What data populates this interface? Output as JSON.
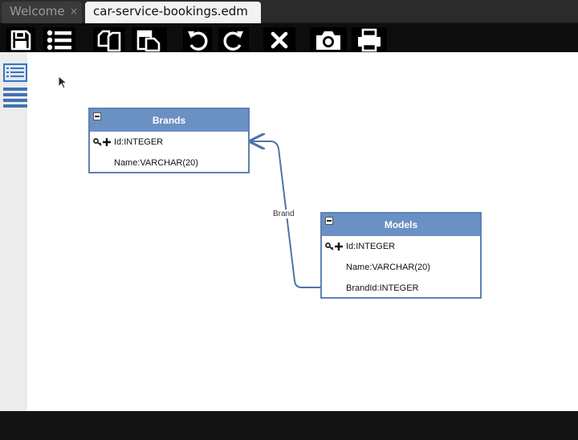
{
  "tabs": [
    {
      "label": "Welcome",
      "close": "×"
    },
    {
      "label": "car-service-bookings.edm"
    }
  ],
  "toolbar": {
    "buttons": [
      "save-icon",
      "list-icon",
      "copy-icon",
      "paste-icon",
      "undo-icon",
      "redo-icon",
      "delete-icon",
      "camera-icon",
      "print-icon"
    ]
  },
  "sidebar": {
    "items": [
      "entity-list-icon",
      "menu-lines-icon"
    ]
  },
  "diagram": {
    "entities": [
      {
        "name": "Brands",
        "fields": [
          {
            "label": "Id:INTEGER",
            "primary_key": true
          },
          {
            "label": "Name:VARCHAR(20)",
            "primary_key": false
          }
        ]
      },
      {
        "name": "Models",
        "fields": [
          {
            "label": "Id:INTEGER",
            "primary_key": true
          },
          {
            "label": "Name:VARCHAR(20)",
            "primary_key": false
          },
          {
            "label": "BrandId:INTEGER",
            "primary_key": false
          }
        ]
      }
    ],
    "relationships": [
      {
        "label": "Brand",
        "from": "Models",
        "to": "Brands"
      }
    ]
  },
  "colors": {
    "entity_header": "#6b90c4",
    "entity_border": "#5d82b4",
    "relationship_line": "#4e74a8",
    "active_tab": "#f2f2f2",
    "toolbar": "#0d0d0d"
  }
}
